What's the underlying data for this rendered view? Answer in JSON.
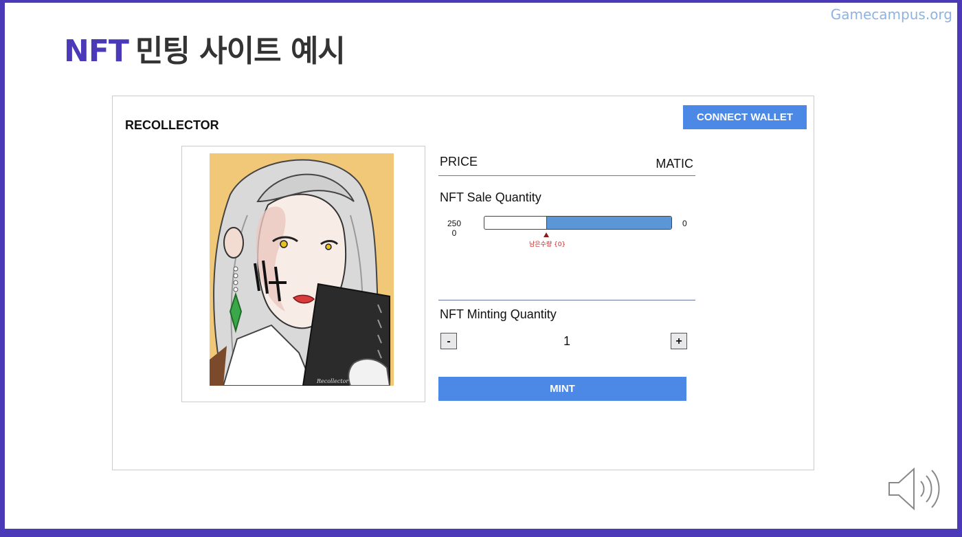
{
  "watermark": "Gamecampus.org",
  "slide": {
    "title_accent": "NFT",
    "title_rest": "민팅 사이트 예시"
  },
  "app": {
    "brand": "RECOLLECTOR",
    "connect_wallet_label": "CONNECT WALLET",
    "artwork": {
      "signature_text": "Recollector"
    },
    "price": {
      "label": "PRICE",
      "unit": "MATIC"
    },
    "sale": {
      "label": "NFT Sale Quantity",
      "total_line1": "250",
      "total_line2": "0",
      "remaining_end": "0",
      "sold_fraction": 0.33,
      "remaining_label": "남은수량 {0}"
    },
    "minting": {
      "label": "NFT Minting Quantity",
      "minus_label": "-",
      "plus_label": "+",
      "quantity": "1",
      "mint_label": "MINT"
    }
  },
  "colors": {
    "frame": "#4a3ab8",
    "accent": "#4a3ab8",
    "button": "#4c88e6",
    "progress": "#5b96d6",
    "artwork_bg": "#f0c878"
  },
  "icons": {
    "speaker": "speaker-icon"
  }
}
